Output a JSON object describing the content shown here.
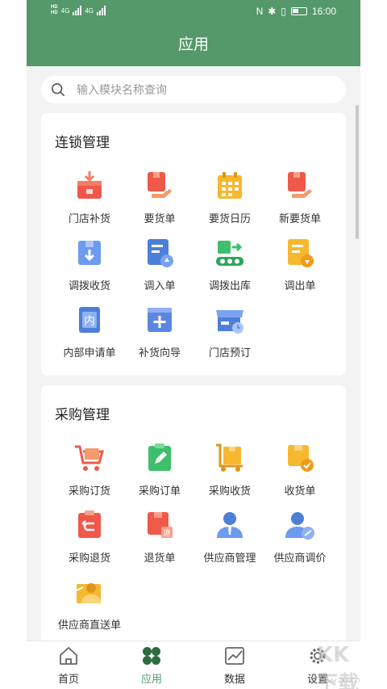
{
  "status": {
    "hd1": "HD",
    "hd2": "HD",
    "net1": "4G",
    "net2": "4G",
    "time": "16:00"
  },
  "header": {
    "title": "应用"
  },
  "search": {
    "placeholder": "输入模块名称查询"
  },
  "sections": [
    {
      "title": "连锁管理",
      "items": [
        {
          "label": "门店补货",
          "icon": "store-replenish-icon"
        },
        {
          "label": "要货单",
          "icon": "request-order-icon"
        },
        {
          "label": "要货日历",
          "icon": "request-calendar-icon"
        },
        {
          "label": "新要货单",
          "icon": "new-request-order-icon"
        },
        {
          "label": "调拨收货",
          "icon": "transfer-receive-icon"
        },
        {
          "label": "调入单",
          "icon": "transfer-in-icon"
        },
        {
          "label": "调拨出库",
          "icon": "transfer-out-icon"
        },
        {
          "label": "调出单",
          "icon": "transfer-out-order-icon"
        },
        {
          "label": "内部申请单",
          "icon": "internal-request-icon"
        },
        {
          "label": "补货向导",
          "icon": "replenish-wizard-icon"
        },
        {
          "label": "门店预订",
          "icon": "store-reservation-icon"
        }
      ]
    },
    {
      "title": "采购管理",
      "items": [
        {
          "label": "采购订货",
          "icon": "purchase-cart-icon"
        },
        {
          "label": "采购订单",
          "icon": "purchase-order-icon"
        },
        {
          "label": "采购收货",
          "icon": "purchase-receive-icon"
        },
        {
          "label": "收货单",
          "icon": "receipt-icon"
        },
        {
          "label": "采购退货",
          "icon": "purchase-return-icon"
        },
        {
          "label": "退货单",
          "icon": "return-order-icon"
        },
        {
          "label": "供应商管理",
          "icon": "supplier-manage-icon"
        },
        {
          "label": "供应商调价",
          "icon": "supplier-price-icon"
        },
        {
          "label": "供应商直送单",
          "icon": "supplier-direct-icon"
        }
      ]
    }
  ],
  "tabbar": [
    {
      "label": "首页",
      "icon": "home-icon"
    },
    {
      "label": "应用",
      "icon": "apps-icon",
      "active": true
    },
    {
      "label": "数据",
      "icon": "chart-icon"
    },
    {
      "label": "设置",
      "icon": "settings-icon"
    }
  ],
  "watermark": {
    "text": "KK下载",
    "url": "www.kkx.net"
  },
  "colors": {
    "brand": "#55986a",
    "orange": "#f28b54",
    "blue": "#4d7fd8",
    "yellow": "#f5b82e",
    "green": "#3dbf6b"
  }
}
